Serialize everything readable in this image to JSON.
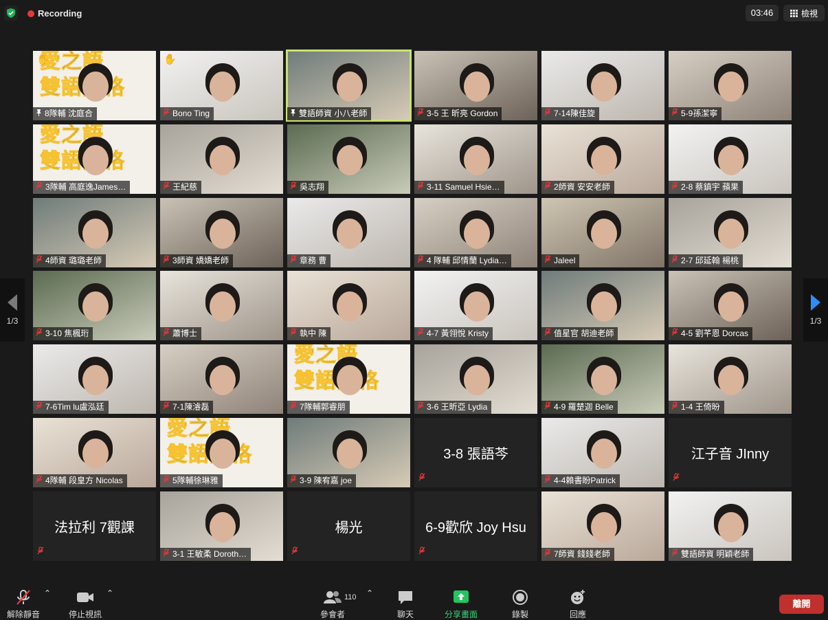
{
  "top": {
    "recording_label": "Recording",
    "timer": "03:46",
    "view_label": "檢視"
  },
  "pager": {
    "left_label": "1/3",
    "right_label": "1/3"
  },
  "participants": [
    {
      "name": "8隊輔 沈庭合",
      "video": true,
      "pinned": true,
      "hand": true,
      "banner": true
    },
    {
      "name": "Bono Ting",
      "video": true,
      "hand": true
    },
    {
      "name": "雙語師資 小八老師",
      "video": true,
      "pinned": true,
      "active": true
    },
    {
      "name": "3-5 王 昕亮 Gordon",
      "video": true
    },
    {
      "name": "7-14陳佳旋",
      "video": true
    },
    {
      "name": "5-9孫潔寧",
      "video": true
    },
    {
      "name": "3隊輔 高庭逸James…",
      "video": true,
      "banner": true
    },
    {
      "name": "王紀慈",
      "video": true
    },
    {
      "name": "吳志翔",
      "video": true
    },
    {
      "name": "3-11 Samuel  Hsie…",
      "video": true
    },
    {
      "name": "2師資  安安老師",
      "video": true
    },
    {
      "name": "2-8 蔡鎮宇 蘋果",
      "video": true
    },
    {
      "name": "4師資 璐璐老師",
      "video": true
    },
    {
      "name": "3師資 嬌嬌老師",
      "video": true
    },
    {
      "name": "章務 曹",
      "video": true
    },
    {
      "name": "4 隊輔 邱情蘭 Lydia…",
      "video": true
    },
    {
      "name": "Jaleel",
      "video": true
    },
    {
      "name": "2-7 邱延翰 楊桃",
      "video": true
    },
    {
      "name": "3-10 焦楓珩",
      "video": true
    },
    {
      "name": "蕭博士",
      "video": true
    },
    {
      "name": "執中 陳",
      "video": true
    },
    {
      "name": "4-7 黃翎悅 Kristy",
      "video": true
    },
    {
      "name": "值星官 胡迪老師",
      "video": true
    },
    {
      "name": "4-5 劉芊恩 Dorcas",
      "video": true
    },
    {
      "name": "7-6Tim lu盧泓廷",
      "video": true
    },
    {
      "name": "7-1陳濬磊",
      "video": true
    },
    {
      "name": "7隊輔郭睿朋",
      "video": true,
      "banner": true
    },
    {
      "name": "3-6 王昕亞 Lydia",
      "video": true
    },
    {
      "name": "4-9 羅楚迦  Belle",
      "video": true
    },
    {
      "name": "1-4 王倚昐",
      "video": true
    },
    {
      "name": "4隊輔 段皇方 Nicolas",
      "video": true
    },
    {
      "name": "5隊輔徐琳雅",
      "video": true,
      "banner": true
    },
    {
      "name": "3-9 陳宥嘉 joe",
      "video": true
    },
    {
      "name": "3-8 張語芩",
      "video": false
    },
    {
      "name": "4-4賴書盼Patrick",
      "video": true
    },
    {
      "name": "江子音 JInny",
      "video": false
    },
    {
      "name": "法拉利 7觀課",
      "video": false
    },
    {
      "name": "3-1 王敏柔 Doroth…",
      "video": true
    },
    {
      "name": "楊光",
      "video": false
    },
    {
      "name": "6-9歡欣 Joy Hsu",
      "video": false
    },
    {
      "name": "7師資 錢錢老師",
      "video": true
    },
    {
      "name": "雙語師資 明穎老師",
      "video": true
    }
  ],
  "toolbar": {
    "unmute": "解除靜音",
    "stop_video": "停止視訊",
    "participants": "參會者",
    "participant_count": "110",
    "chat": "聊天",
    "share": "分享畫面",
    "record": "錄製",
    "reactions": "回應",
    "leave": "離開"
  },
  "colors": {
    "active_border": "#c9e26f",
    "share_green": "#23c55e",
    "leave_red": "#c0302c",
    "accent_blue": "#2d8cff"
  },
  "banner_text": {
    "line1": "愛之語",
    "line2": "雙語品格"
  }
}
